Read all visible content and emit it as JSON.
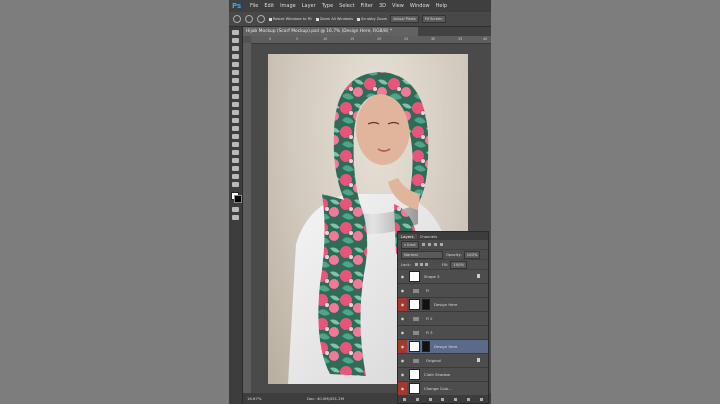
{
  "app": {
    "logo": "Ps",
    "title": "Hijab Mockup (Scarf Mockup).psd @ 16.7% (Design Here, RGB/8) *"
  },
  "menu": [
    "File",
    "Edit",
    "Image",
    "Layer",
    "Type",
    "Select",
    "Filter",
    "3D",
    "View",
    "Window",
    "Help"
  ],
  "options": {
    "resize": "Resize Windows to Fit",
    "zoom_all": "Zoom All Windows",
    "scrubby": "Scrubby Zoom",
    "actual": "Actual Pixels",
    "fit": "Fit Screen"
  },
  "ruler": [
    "0",
    "5",
    "10",
    "15",
    "20",
    "25",
    "30",
    "35",
    "40"
  ],
  "status": {
    "zoom": "16.67%",
    "doc": "Doc: 40.0M/451.2M"
  },
  "layers_panel": {
    "tabs": [
      "Layers",
      "Channels"
    ],
    "kind": "Kind",
    "blend": "Normal",
    "opacity_label": "Opacity:",
    "opacity": "100%",
    "lock_label": "Lock:",
    "fill_label": "Fill:",
    "fill": "100%",
    "layers": [
      {
        "name": "Shape 3",
        "type": "layer",
        "eye_red": false,
        "selected": false,
        "lock": true
      },
      {
        "name": "Fi",
        "type": "group",
        "eye_red": false,
        "selected": false,
        "lock": false
      },
      {
        "name": "Design Here",
        "type": "smart",
        "eye_red": true,
        "selected": false,
        "lock": false
      },
      {
        "name": "Fi 2",
        "type": "group",
        "eye_red": false,
        "selected": false,
        "lock": false
      },
      {
        "name": "Fi 3",
        "type": "group",
        "eye_red": false,
        "selected": false,
        "lock": false
      },
      {
        "name": "Design Here",
        "type": "smart",
        "eye_red": true,
        "selected": true,
        "lock": false
      },
      {
        "name": "Original",
        "type": "group",
        "eye_red": false,
        "selected": false,
        "lock": true
      },
      {
        "name": "Cloth Shadow",
        "type": "layer",
        "eye_red": false,
        "selected": false,
        "lock": false
      },
      {
        "name": "Change Colo...",
        "type": "layer",
        "eye_red": true,
        "selected": false,
        "lock": false
      }
    ]
  },
  "colors": {
    "accent": "#31a8ff",
    "panel": "#4d4d4d",
    "highlight": "#5a6a8a",
    "eye_red": "#a03a30"
  }
}
